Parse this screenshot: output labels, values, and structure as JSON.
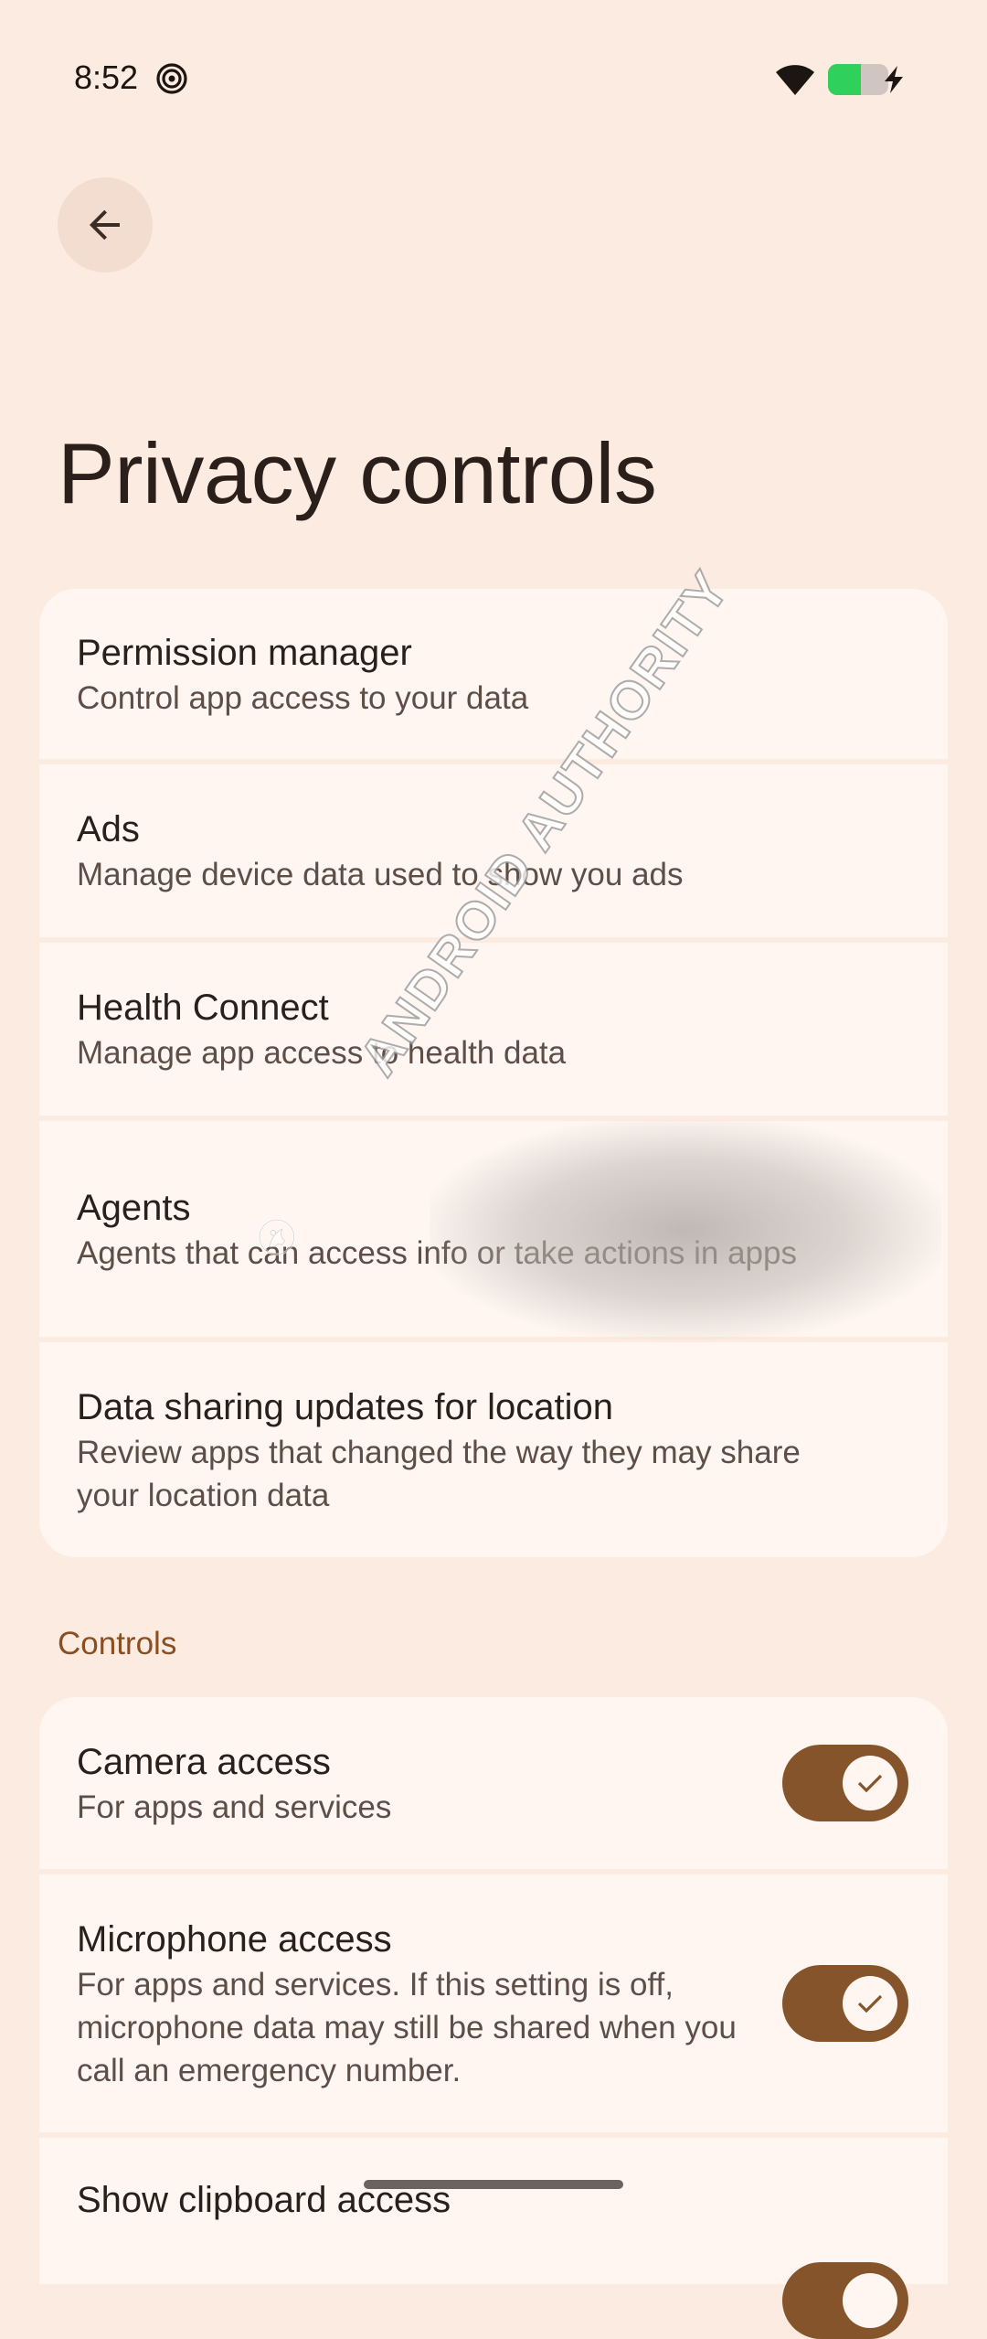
{
  "status_bar": {
    "time": "8:52",
    "spiral_icon": "spiral-icon",
    "wifi_icon": "wifi-icon",
    "battery_icon": "battery-charging-icon",
    "battery_level": 0.45
  },
  "header": {
    "back_icon": "arrow-back-icon",
    "title": "Privacy controls"
  },
  "privacy_items": [
    {
      "title": "Permission manager",
      "subtitle": "Control app access to your data"
    },
    {
      "title": "Ads",
      "subtitle": "Manage device data used to show you ads"
    },
    {
      "title": "Health Connect",
      "subtitle": "Manage app access to health data"
    },
    {
      "title": "Agents",
      "subtitle": "Agents that can access info or take actions in apps"
    },
    {
      "title": "Data sharing updates for location",
      "subtitle": "Review apps that changed the way they may share your location data"
    }
  ],
  "controls": {
    "header": "Controls",
    "items": [
      {
        "title": "Camera access",
        "subtitle": "For apps and services",
        "enabled": true
      },
      {
        "title": "Microphone access",
        "subtitle": "For apps and services. If this setting is off, microphone data may still be shared when you call an emergency number.",
        "enabled": true
      },
      {
        "title": "Show clipboard access",
        "subtitle": "",
        "enabled": true
      }
    ]
  },
  "watermark": {
    "text": "ANDROID AUTHORITY"
  },
  "colors": {
    "background": "#fcebe0",
    "card": "#fff6f1",
    "accent": "#85542a",
    "section_header": "#8a4f20"
  }
}
